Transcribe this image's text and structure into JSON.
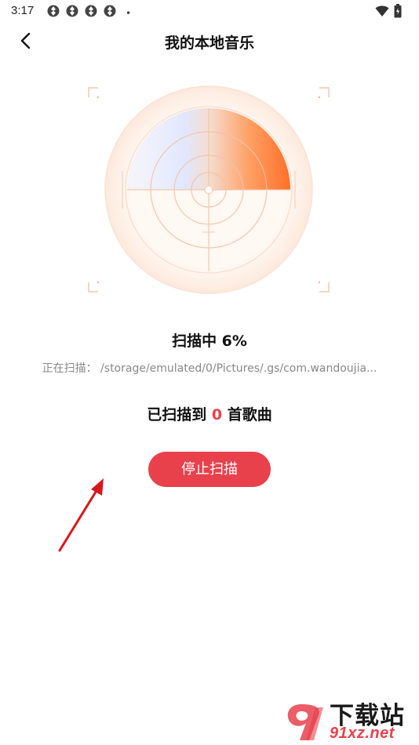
{
  "status_bar": {
    "time": "3:17",
    "icons": [
      "app-notification-icon",
      "app-notification-icon",
      "app-notification-icon",
      "app-notification-icon"
    ],
    "dot": "•",
    "right_icons": [
      "wifi-icon",
      "battery-icon"
    ]
  },
  "nav": {
    "back_icon": "chevron-left-icon",
    "title": "我的本地音乐"
  },
  "scan": {
    "progress_percent": 6,
    "status_text": "扫描中 6%",
    "path_text": "正在扫描： /storage/emulated/0/Pictures/.gs/com.wandoujia...",
    "count_prefix": "已扫描到 ",
    "count_value": "0",
    "count_suffix": " 首歌曲",
    "stop_label": "停止扫描"
  },
  "watermark": {
    "title": "下载站",
    "url": "91xz.net",
    "logo": "91-logo"
  },
  "colors": {
    "accent": "#e8414c",
    "radar_orange": "#ff7a2e",
    "radar_blue": "#dbe6ff",
    "arrow": "#d9161c"
  }
}
